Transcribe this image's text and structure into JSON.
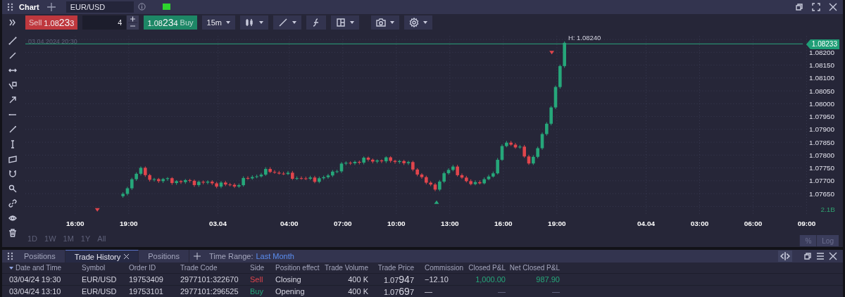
{
  "window": {
    "title": "Chart"
  },
  "symbol_field": {
    "value": "EUR/USD"
  },
  "toolbar": {
    "sell": {
      "label": "Sell",
      "price": {
        "prefix": "1.08",
        "pips": "23",
        "tail": "3"
      }
    },
    "quantity": {
      "value": "4"
    },
    "buy": {
      "label": "Buy",
      "price": {
        "prefix": "1.08",
        "pips": "23",
        "tail": "4"
      }
    },
    "timeframe": "15m"
  },
  "chart": {
    "date_label": "03.04.2024 20:30",
    "high_label": "H: 1.08240",
    "current_price": "1.08233",
    "price_ticks": [
      "1.08200",
      "1.08150",
      "1.08100",
      "1.08050",
      "1.08000",
      "1.07950",
      "1.07900",
      "1.07850",
      "1.07800",
      "1.07750",
      "1.07700",
      "1.07650"
    ],
    "volume_label": "2.1B",
    "time_ticks": [
      "16:00",
      "19:00",
      "03.04",
      "04:00",
      "07:00",
      "10:00",
      "13:00",
      "16:00",
      "19:00",
      "04.04",
      "03:00",
      "06:00",
      "09:00"
    ],
    "ranges": [
      "1D",
      "1W",
      "1M",
      "1Y",
      "All"
    ],
    "scale_buttons": [
      "%",
      "Log"
    ]
  },
  "panel": {
    "tabs": [
      {
        "label": "Positions",
        "selected": false,
        "closable": false
      },
      {
        "label": "Trade History",
        "selected": true,
        "closable": true
      },
      {
        "label": "Positions",
        "selected": false,
        "closable": false
      }
    ],
    "time_range": {
      "label": "Time Range:",
      "value": "Last Month"
    },
    "columns": [
      {
        "label": "Date and Time",
        "sorted": true
      },
      {
        "label": "Symbol",
        "sorted": false
      },
      {
        "label": "Order ID",
        "sorted": false
      },
      {
        "label": "Trade Code",
        "sorted": false
      },
      {
        "label": "Side",
        "sorted": false
      },
      {
        "label": "Position effect",
        "sorted": false
      },
      {
        "label": "Trade Volume",
        "sorted": false
      },
      {
        "label": "Trade Price",
        "sorted": false
      },
      {
        "label": "Commission",
        "sorted": false
      },
      {
        "label": "Closed P&L",
        "sorted": false
      },
      {
        "label": "Net Closed P&L",
        "sorted": false
      }
    ],
    "rows": [
      {
        "date": "03/04/24 19:30",
        "symbol": "EUR/USD",
        "order_id": "19753409",
        "trade_code": "2977101:322670",
        "side": {
          "text": "Sell",
          "kind": "sell"
        },
        "position_effect": "Closing",
        "trade_volume": "400 K",
        "trade_price": {
          "prefix": "1.07",
          "pips": "94",
          "tail": "7"
        },
        "commission": "−12.10",
        "closed_pnl": "1,000.00",
        "net_closed_pnl": "987.90",
        "profit": true
      },
      {
        "date": "03/04/24 13:10",
        "symbol": "EUR/USD",
        "order_id": "19753101",
        "trade_code": "2977101:296525",
        "side": {
          "text": "Buy",
          "kind": "buy"
        },
        "position_effect": "Opening",
        "trade_volume": "400 K",
        "trade_price": {
          "prefix": "1.07",
          "pips": "69",
          "tail": "7"
        },
        "commission": "—",
        "closed_pnl": "—",
        "net_closed_pnl": "—",
        "profit": false
      }
    ]
  }
}
